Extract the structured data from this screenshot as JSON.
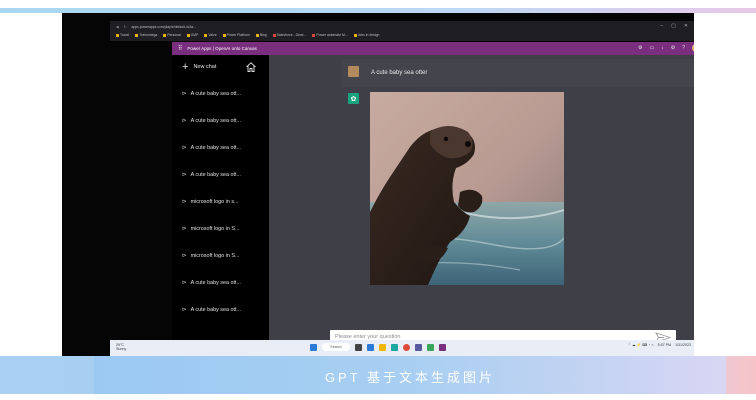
{
  "browser": {
    "bookmarks": [
      "Travel",
      "Trainomega",
      "Personal",
      "OMP",
      "Valve",
      "Power Platform",
      "Blog",
      "Salesforce - Deve...",
      "Power automate M...",
      "Jobs in design"
    ],
    "url": "apps.powerapps.com/play/e/default-4c3a..."
  },
  "app": {
    "title": "Power Apps | OpenAI onto Canvas",
    "header_icons": [
      "settings-icon",
      "download-icon",
      "gear-icon",
      "help-icon"
    ]
  },
  "sidebar": {
    "new_chat": "New chat",
    "history": [
      "A cute baby sea ott...",
      "A cute baby sea ott...",
      "A cute baby sea ott...",
      "A cute baby sea ott...",
      "microsoft logo in s...",
      "microsoft logo in S...",
      "microsoft logo in S...",
      "A cute baby sea ott...",
      "A cute baby sea ott..."
    ]
  },
  "chat": {
    "user_message": "A cute baby sea otter",
    "input_placeholder": "Please enter your question"
  },
  "taskbar": {
    "weather_temp": "29°C",
    "weather_desc": "Sunny",
    "search": "Search",
    "time": "5:57 PM",
    "date": "1/31/2023"
  },
  "banner": {
    "title": "GPT 基于文本生成图片"
  },
  "colors": {
    "powerapps_header": "#7a2f7e",
    "sidebar": "#000000",
    "main_bg": "#3f3f47",
    "gpt_avatar": "#19a37f"
  }
}
